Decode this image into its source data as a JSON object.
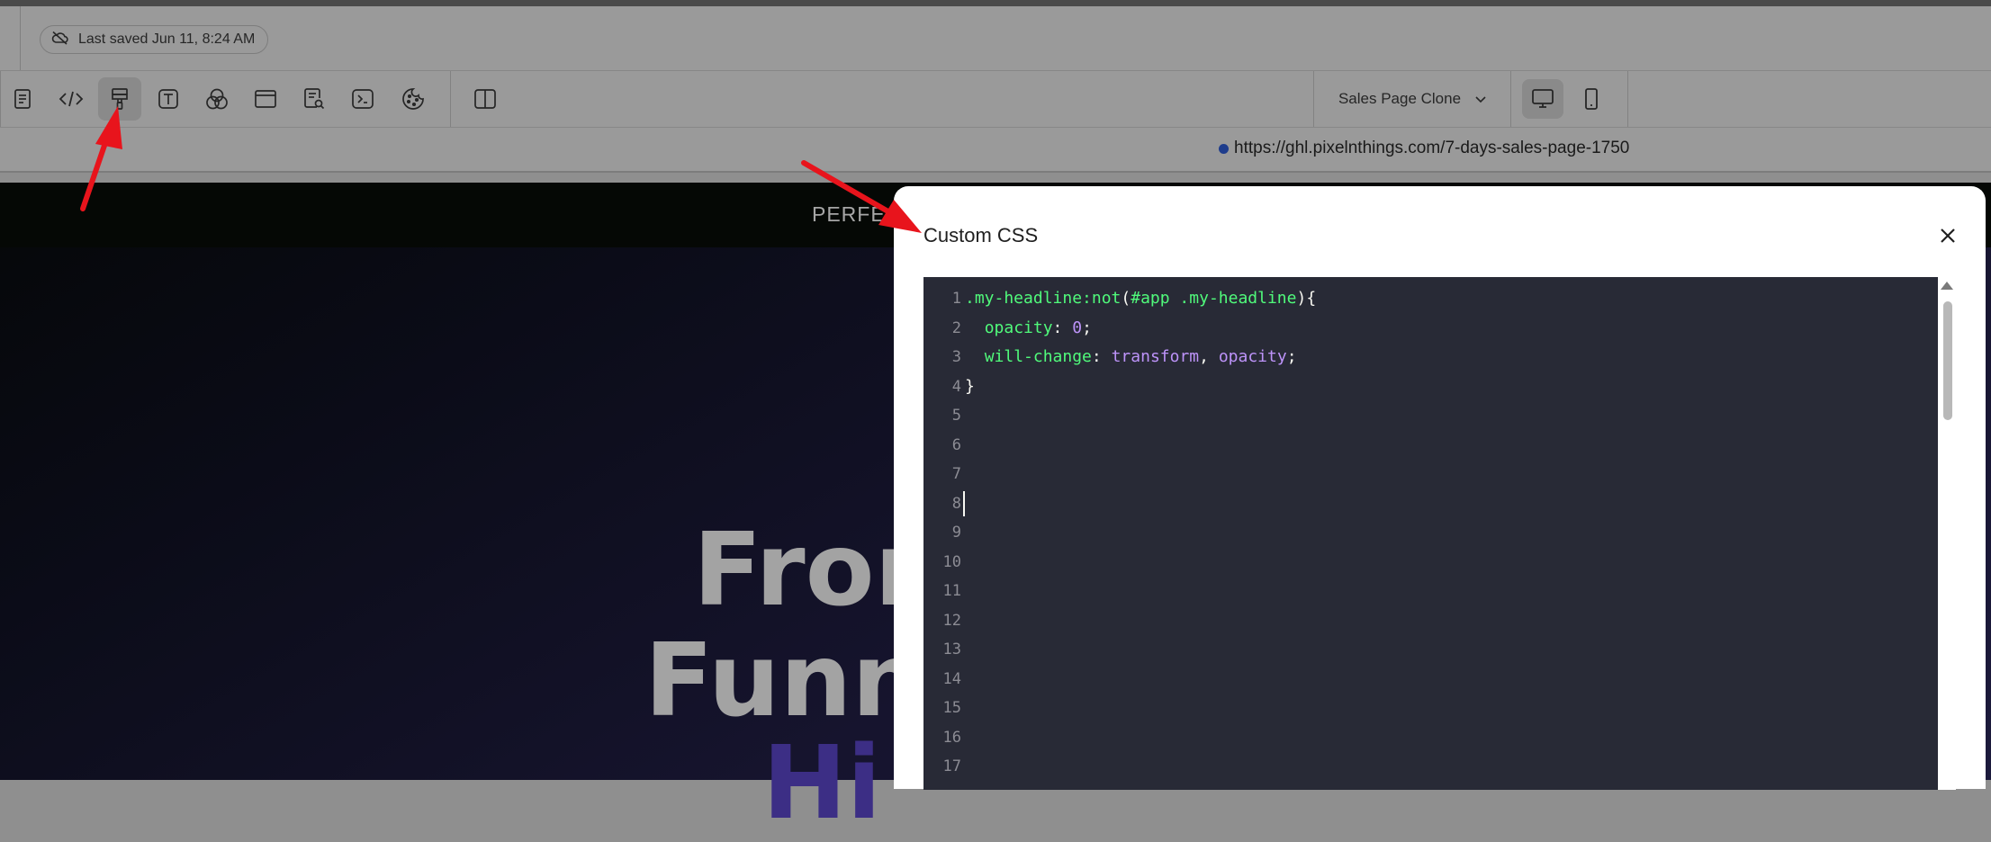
{
  "header": {
    "saved_status": "Last saved Jun 11, 8:24 AM",
    "saved_icon": "cloud-off-icon"
  },
  "toolbar": {
    "tools": [
      {
        "name": "pages-icon"
      },
      {
        "name": "code-icon"
      },
      {
        "name": "paint-brush-icon",
        "active": true
      },
      {
        "name": "text-icon"
      },
      {
        "name": "color-circles-icon"
      },
      {
        "name": "layout-icon"
      },
      {
        "name": "page-search-icon"
      },
      {
        "name": "terminal-icon"
      },
      {
        "name": "cookie-icon"
      },
      {
        "name": "split-view-icon"
      }
    ],
    "page_select": {
      "value": "Sales Page Clone"
    },
    "devices": [
      {
        "name": "desktop-icon",
        "active": true
      },
      {
        "name": "mobile-icon",
        "active": false
      }
    ]
  },
  "address_bar": {
    "url": "https://ghl.pixelnthings.com/7-days-sales-page-1750"
  },
  "canvas": {
    "top_text": "PERFE",
    "hero_line1": "Fron",
    "hero_line2": "Funn",
    "hero_line3": "Hi"
  },
  "modal": {
    "title": "Custom CSS",
    "close_label": "×",
    "code_lines": [
      ".my-headline:not(#app .my-headline){",
      "  opacity: 0;",
      "  will-change: transform, opacity;",
      "}",
      "",
      "",
      "",
      "",
      "",
      "",
      "",
      "",
      "",
      "",
      "",
      "",
      ""
    ],
    "line_numbers": [
      "1",
      "2",
      "3",
      "4",
      "5",
      "6",
      "7",
      "8",
      "9",
      "10",
      "11",
      "12",
      "13",
      "14",
      "15",
      "16",
      "17"
    ],
    "cursor_line": 8
  },
  "colors": {
    "editor_bg": "#282a36",
    "selector": "#50fa7b",
    "number": "#bd93f9",
    "annotation_arrow": "#e8141c"
  }
}
